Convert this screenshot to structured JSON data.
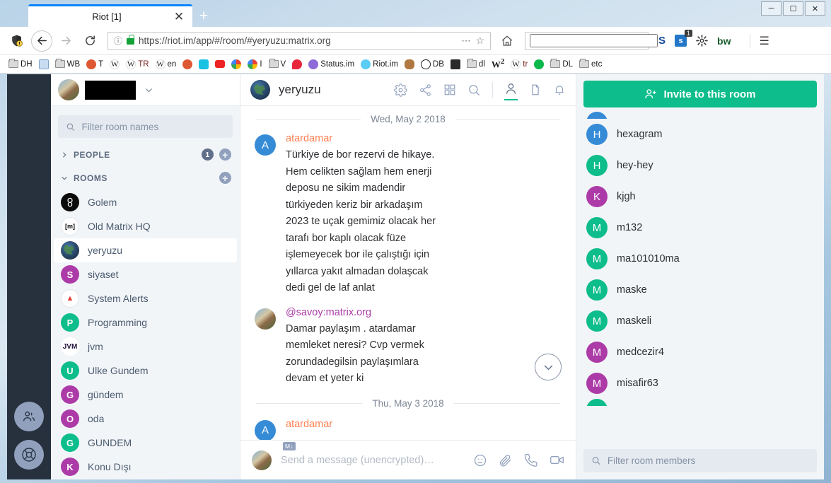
{
  "browser": {
    "tab_title": "Riot [1]",
    "new_tab_label": "+",
    "close_label": "✕",
    "url": "https://riot.im/app/#/room/#yeryuzu:matrix.org",
    "url_scheme": "https://",
    "minimize_label": "–",
    "maximize_label": "❐",
    "close_win_label": "✕",
    "search_placeholder": "",
    "bookmarks": [
      {
        "label": "DH",
        "icon": "folder-icon"
      },
      {
        "label": "",
        "icon": "bookmark-blue-icon"
      },
      {
        "label": "WB",
        "icon": "folder-icon"
      },
      {
        "label": "T",
        "icon": "duckduckgo-icon"
      },
      {
        "label": "",
        "icon": "wikipedia-icon"
      },
      {
        "label": "TR",
        "icon": "wikipedia-icon"
      },
      {
        "label": "en",
        "icon": "wikipedia-icon"
      },
      {
        "label": "",
        "icon": "duckduckgo-icon"
      },
      {
        "label": "",
        "icon": "cyan-c-icon"
      },
      {
        "label": "",
        "icon": "youtube-icon"
      },
      {
        "label": "",
        "icon": "google-icon"
      },
      {
        "label": "I",
        "icon": "google-icon"
      },
      {
        "label": "V",
        "icon": "folder-icon"
      },
      {
        "label": "",
        "icon": "chat-bubble-icon"
      },
      {
        "label": "Status.im",
        "icon": "status-icon"
      },
      {
        "label": "Riot.im",
        "icon": "riot-icon"
      },
      {
        "label": "",
        "icon": "squirrel-icon"
      },
      {
        "label": "DB",
        "icon": "globe-icon"
      },
      {
        "label": "",
        "icon": "bank-icon"
      },
      {
        "label": "dl",
        "icon": "folder-icon"
      },
      {
        "label": "2",
        "icon": "w-superscript-icon"
      },
      {
        "label": "tr",
        "icon": "wikipedia-icon"
      },
      {
        "label": "",
        "icon": "green-dot-icon"
      },
      {
        "label": "DL",
        "icon": "folder-icon"
      },
      {
        "label": "etc",
        "icon": "folder-icon"
      }
    ],
    "extensions": [
      {
        "label": "S",
        "icon": "skype-icon"
      },
      {
        "label": "s",
        "icon": "extension-badge-icon",
        "badge": "1"
      },
      {
        "label": "",
        "icon": "gear-icon"
      },
      {
        "label": "bw",
        "icon": "bitwarden-icon"
      }
    ]
  },
  "rail": {
    "buttons": [
      {
        "name": "community-button",
        "icon": "people-icon"
      },
      {
        "name": "help-button",
        "icon": "lifebuoy-icon"
      }
    ]
  },
  "roomlist": {
    "profile": {
      "display_name": ""
    },
    "filter_placeholder": "Filter room names",
    "sections": [
      {
        "label": "PEOPLE",
        "expanded": false,
        "badge": "1",
        "chevron": "›"
      },
      {
        "label": "ROOMS",
        "expanded": true,
        "badge": "",
        "chevron": "∨"
      }
    ],
    "rooms": [
      {
        "name": "Golem",
        "initial": "",
        "color": "#000000",
        "selected": false,
        "avatar": "golem-logo"
      },
      {
        "name": "Old Matrix HQ",
        "initial": "[m]",
        "color": "#ffffff",
        "selected": false,
        "avatar": "matrix-logo"
      },
      {
        "name": "yeryuzu",
        "initial": "",
        "color": "#1f3348",
        "selected": true,
        "avatar": "earth-photo"
      },
      {
        "name": "siyaset",
        "initial": "S",
        "color": "#ac3ba8",
        "selected": false,
        "avatar": "letter"
      },
      {
        "name": "System Alerts",
        "initial": "▲",
        "color": "#ffffff",
        "selected": false,
        "avatar": "alert-logo"
      },
      {
        "name": "Programming",
        "initial": "P",
        "color": "#0dbd8b",
        "selected": false,
        "avatar": "letter"
      },
      {
        "name": "jvm",
        "initial": "JVM",
        "color": "#ffffff",
        "selected": false,
        "avatar": "jvm-logo"
      },
      {
        "name": "Ulke Gundem",
        "initial": "U",
        "color": "#0dbd8b",
        "selected": false,
        "avatar": "letter"
      },
      {
        "name": "gündem",
        "initial": "G",
        "color": "#ac3ba8",
        "selected": false,
        "avatar": "letter"
      },
      {
        "name": "oda",
        "initial": "O",
        "color": "#ac3ba8",
        "selected": false,
        "avatar": "letter"
      },
      {
        "name": "GUNDEM",
        "initial": "G",
        "color": "#0dbd8b",
        "selected": false,
        "avatar": "letter"
      },
      {
        "name": "Konu Dışı",
        "initial": "K",
        "color": "#ac3ba8",
        "selected": false,
        "avatar": "letter"
      }
    ]
  },
  "room": {
    "title": "yeryuzu",
    "header_icons": [
      {
        "name": "room-settings-icon",
        "label": "gear-icon"
      },
      {
        "name": "share-room-icon",
        "label": "share-icon"
      },
      {
        "name": "apps-icon",
        "label": "grid-icon"
      },
      {
        "name": "search-room-icon",
        "label": "search-icon"
      },
      {
        "name": "member-list-icon",
        "label": "person-icon",
        "active": true
      },
      {
        "name": "file-panel-icon",
        "label": "file-icon"
      },
      {
        "name": "notifications-icon",
        "label": "bell-icon"
      }
    ]
  },
  "timeline": {
    "events": [
      {
        "type": "daysep",
        "label": "Wed, May 2 2018"
      },
      {
        "type": "message",
        "sender": "atardamar",
        "sender_color": "#ff7f50",
        "avatar_initial": "A",
        "avatar_color": "#368bd6",
        "lines": [
          "Türkiye de bor rezervi de hikaye.",
          "Hem celikten sağlam hem  enerji",
          "deposu ne sikim madendir",
          "türkiyeden keriz bir arkadaşım",
          "2023 te uçak gemimiz olacak her",
          "tarafı bor kaplı olacak füze",
          "işlemeyecek bor ile çalıştığı için",
          "yıllarca yakıt almadan dolaşcak",
          "dedi gel de laf anlat"
        ]
      },
      {
        "type": "message",
        "sender": "@savoy:matrix.org",
        "sender_color": "#ac3ba8",
        "avatar_initial": "",
        "avatar_color": "#8c6a49",
        "avatar_photo": true,
        "lines": [
          "Damar paylaşım . atardamar",
          "memleket neresi? Cvp vermek",
          "zorundadegilsin paylaşımlara",
          "devam et yeter ki"
        ]
      },
      {
        "type": "daysep",
        "label": "Thu, May 3 2018"
      },
      {
        "type": "message",
        "sender": "atardamar",
        "sender_color": "#ff7f50",
        "avatar_initial": "A",
        "avatar_color": "#368bd6",
        "lines": []
      }
    ],
    "jump_to_bottom_icon": "chevron-down-icon"
  },
  "composer": {
    "markdown_badge": "M↓",
    "placeholder": "Send a message (unencrypted)…",
    "value": "",
    "icons": [
      {
        "name": "emoji-icon"
      },
      {
        "name": "attachment-icon"
      },
      {
        "name": "voice-call-icon"
      },
      {
        "name": "video-call-icon"
      }
    ]
  },
  "members": {
    "invite_label": "Invite to this room",
    "invite_icon": "person-add-icon",
    "filter_placeholder": "Filter room members",
    "list": [
      {
        "name": "hexagram",
        "initial": "H",
        "color": "#368bd6"
      },
      {
        "name": "hey-hey",
        "initial": "H",
        "color": "#0dbd8b"
      },
      {
        "name": "kjgh",
        "initial": "K",
        "color": "#ac3ba8"
      },
      {
        "name": "m132",
        "initial": "M",
        "color": "#0dbd8b"
      },
      {
        "name": "ma101010ma",
        "initial": "M",
        "color": "#0dbd8b"
      },
      {
        "name": "maske",
        "initial": "M",
        "color": "#0dbd8b"
      },
      {
        "name": "maskeli",
        "initial": "M",
        "color": "#0dbd8b"
      },
      {
        "name": "medcezir4",
        "initial": "M",
        "color": "#ac3ba8"
      },
      {
        "name": "misafir63",
        "initial": "M",
        "color": "#ac3ba8"
      }
    ]
  },
  "colors": {
    "accent_green": "#0dbd8b",
    "rail_dark": "#27303d",
    "panel_bg": "#f2f5f8",
    "text_primary": "#2e2f32",
    "text_secondary": "#61708a"
  }
}
